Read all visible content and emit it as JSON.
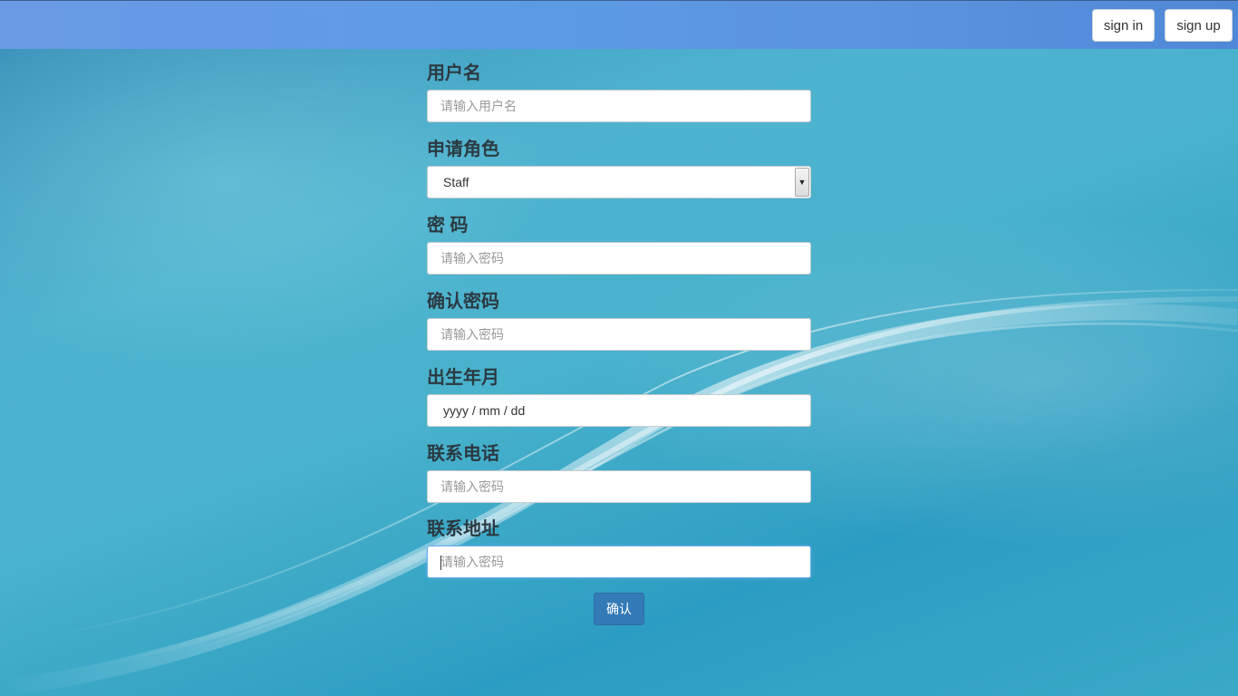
{
  "nav": {
    "sign_in": "sign in",
    "sign_up": "sign up"
  },
  "form": {
    "fields": [
      {
        "label": "用户名",
        "placeholder": "请输入用户名"
      },
      {
        "label": "申请角色",
        "value": "Staff"
      },
      {
        "label": "密 码",
        "placeholder": "请输入密码"
      },
      {
        "label": "确认密码",
        "placeholder": "请输入密码"
      },
      {
        "label": "出生年月",
        "value": "yyyy / mm / dd"
      },
      {
        "label": "联系电话",
        "placeholder": "请输入密码"
      },
      {
        "label": "联系地址",
        "placeholder": "请输入密码"
      }
    ],
    "submit_label": "确认"
  },
  "colors": {
    "navbar": "#5d9be6",
    "primary_button": "#337ab7"
  }
}
